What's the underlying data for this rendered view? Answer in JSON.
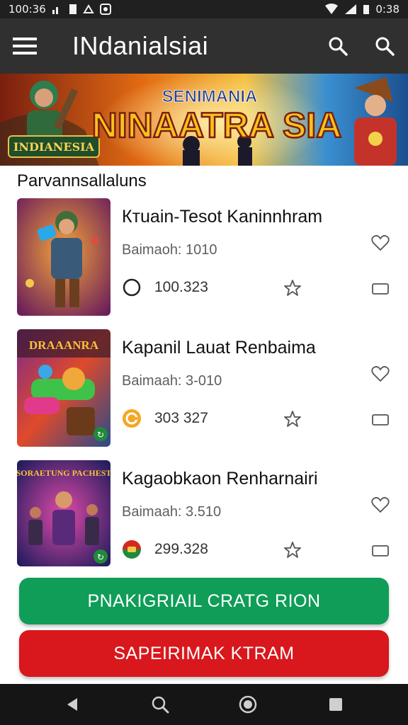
{
  "status_bar": {
    "left_text": "100:36",
    "right_text": "0:38",
    "icons": [
      "signal-icon",
      "battery-icon",
      "notification-icon",
      "app-icon",
      "wifi-icon",
      "signal-icon",
      "battery-icon"
    ]
  },
  "app_bar": {
    "title": "INdanialsiai",
    "menu_icon": "hamburger-menu-icon",
    "action_icons": [
      "search-icon",
      "search-icon"
    ]
  },
  "banner": {
    "tagline": "SENIMANIA",
    "headline": "NINAATRA SIA",
    "badge": "INDIANESIA",
    "colors": [
      "#1b5fa8",
      "#f7b21a",
      "#d33a1e"
    ]
  },
  "section": {
    "title": "Parvannsallaluns"
  },
  "games": [
    {
      "title": "Ктuain-Tesot Kaninnhram",
      "subtitle": "Baimaoh: 1010",
      "stat": "100.323",
      "stat_icon": "circle-outline-icon",
      "thumb_label": ""
    },
    {
      "title": "Kapanil Lauat Renbaima",
      "subtitle": "Baimaah: 3-010",
      "stat": "303 327",
      "stat_icon": "orange-badge-icon",
      "thumb_label": "DRAAANRA"
    },
    {
      "title": "Kagaobkaon Renharnairi",
      "subtitle": "Baimaah: 3.510",
      "stat": "299.328",
      "stat_icon": "flag-badge-icon",
      "thumb_label": "SORAETUNG PACHEST"
    }
  ],
  "buttons": {
    "primary": "PNAKIGRIAIL CRATG RION",
    "secondary": "SAPEIRIMAK KTRAM",
    "primary_color": "#0f9d58",
    "secondary_color": "#d8181d"
  },
  "nav": {
    "items": [
      "back-icon",
      "search-icon",
      "home-icon",
      "recents-icon"
    ]
  }
}
